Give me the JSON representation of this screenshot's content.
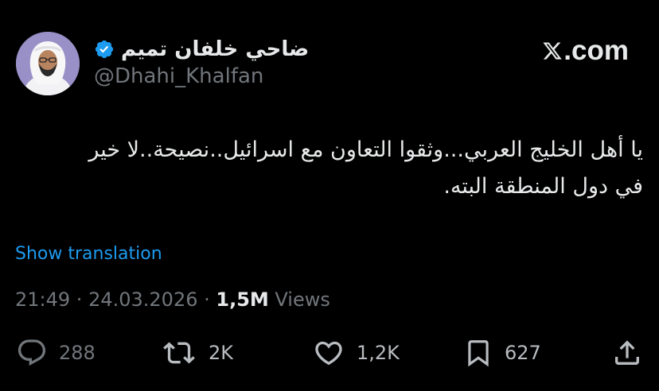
{
  "author": {
    "display_name": "ضاحي خلفان تميم",
    "handle": "@Dhahi_Khalfan",
    "verified": true
  },
  "brand": {
    "x_logo_icon": "x-logo-icon",
    "domain": ".com"
  },
  "tweet": {
    "text_line1": "يا أهل الخليج العربي...وثقوا التعاون مع اسرائيل..نصيحة..لا خير",
    "text_line2": "في دول المنطقة البته."
  },
  "translate_link": "Show translation",
  "meta": {
    "time": "21:49",
    "separator1": " · ",
    "date": "24.03.2026",
    "separator2": " · ",
    "views_count": "1,5M",
    "views_label": " Views"
  },
  "actions": {
    "replies": "288",
    "reposts": "2K",
    "likes": "1,2K",
    "bookmarks": "627"
  },
  "colors": {
    "background": "#000000",
    "text_primary": "#e7e9ea",
    "text_secondary": "#71767b",
    "link": "#1d9bf0",
    "verified": "#1d9bf0"
  }
}
